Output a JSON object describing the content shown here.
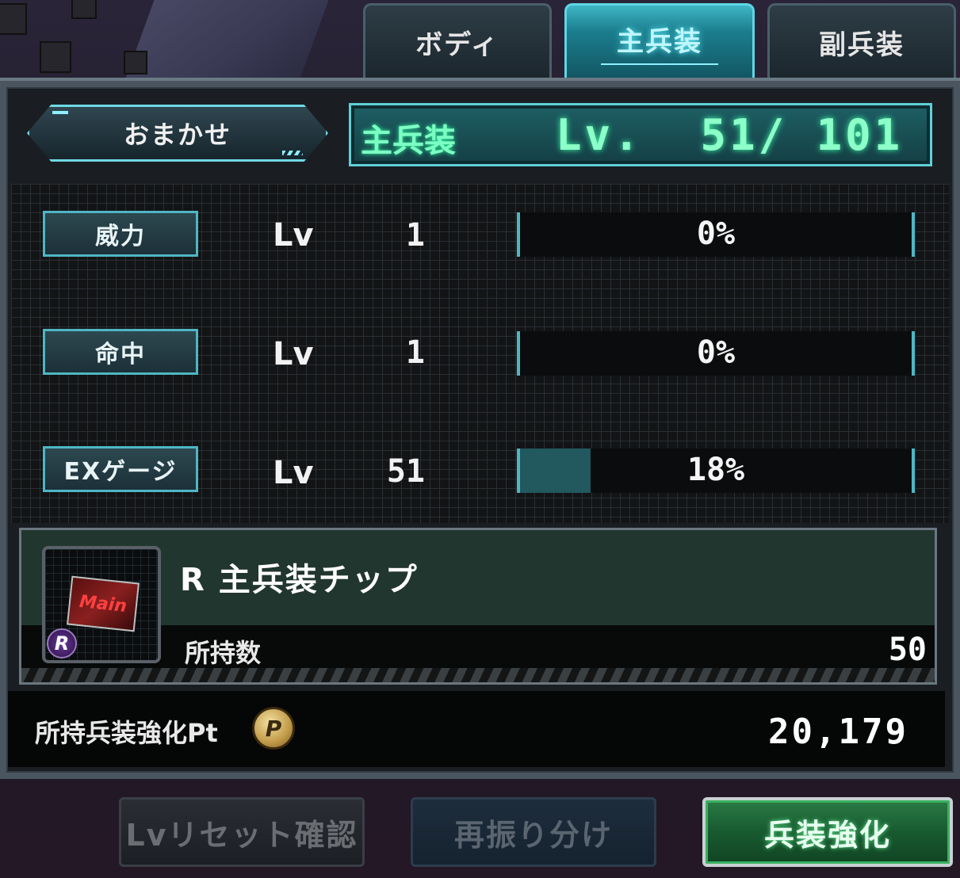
{
  "tabs": [
    {
      "label": "ボディ",
      "active": false
    },
    {
      "label": "主兵装",
      "active": true
    },
    {
      "label": "副兵装",
      "active": false
    }
  ],
  "omakase_label": "おまかせ",
  "level_display": {
    "title": "主兵装",
    "text": "Lv.  51/ 101",
    "current": 51,
    "max": 101
  },
  "stats": [
    {
      "label": "威力",
      "lv_label": "Lv",
      "level": "1",
      "percent_text": "0%",
      "percent": 0
    },
    {
      "label": "命中",
      "lv_label": "Lv",
      "level": "1",
      "percent_text": "0%",
      "percent": 0
    },
    {
      "label": "EXゲージ",
      "lv_label": "Lv",
      "level": "51",
      "percent_text": "18%",
      "percent": 18
    }
  ],
  "chip": {
    "name": "R 主兵装チップ",
    "icon_text": "Main",
    "rarity": "R",
    "count_label": "所持数",
    "count": "50"
  },
  "points": {
    "label": "所持兵装強化Pt",
    "coin_glyph": "P",
    "value": "20,179"
  },
  "buttons": {
    "reset": "Lvリセット確認",
    "redistribute": "再振り分け",
    "enhance": "兵装強化"
  },
  "colors": {
    "accent_cyan": "#5fd0d8",
    "level_green": "#8dffc8",
    "enhance_green": "#2a7a44"
  }
}
